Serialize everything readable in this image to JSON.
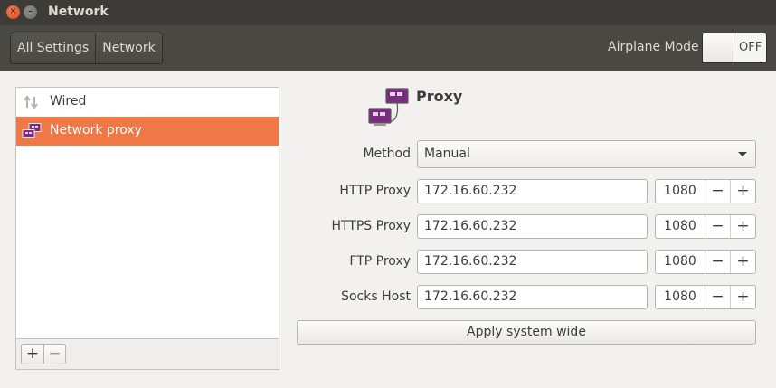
{
  "window": {
    "title": "Network"
  },
  "toolbar": {
    "breadcrumbs": [
      "All Settings",
      "Network"
    ],
    "airplane_label": "Airplane Mode",
    "airplane_state": "OFF"
  },
  "sidebar": {
    "items": [
      {
        "label": "Wired",
        "icon": "wired-network-icon",
        "selected": false
      },
      {
        "label": "Network proxy",
        "icon": "network-proxy-icon",
        "selected": true
      }
    ],
    "add_symbol": "+",
    "remove_symbol": "−"
  },
  "proxy": {
    "title": "Proxy",
    "method_label": "Method",
    "method_value": "Manual",
    "rows": [
      {
        "label": "HTTP Proxy",
        "host": "172.16.60.232",
        "port": "1080"
      },
      {
        "label": "HTTPS Proxy",
        "host": "172.16.60.232",
        "port": "1080"
      },
      {
        "label": "FTP Proxy",
        "host": "172.16.60.232",
        "port": "1080"
      },
      {
        "label": "Socks Host",
        "host": "172.16.60.232",
        "port": "1080"
      }
    ],
    "minus_symbol": "−",
    "plus_symbol": "+",
    "apply_label": "Apply system wide"
  },
  "colors": {
    "selection": "#f07746",
    "titlebar": "#3c3b37",
    "toolbar": "#494842"
  }
}
